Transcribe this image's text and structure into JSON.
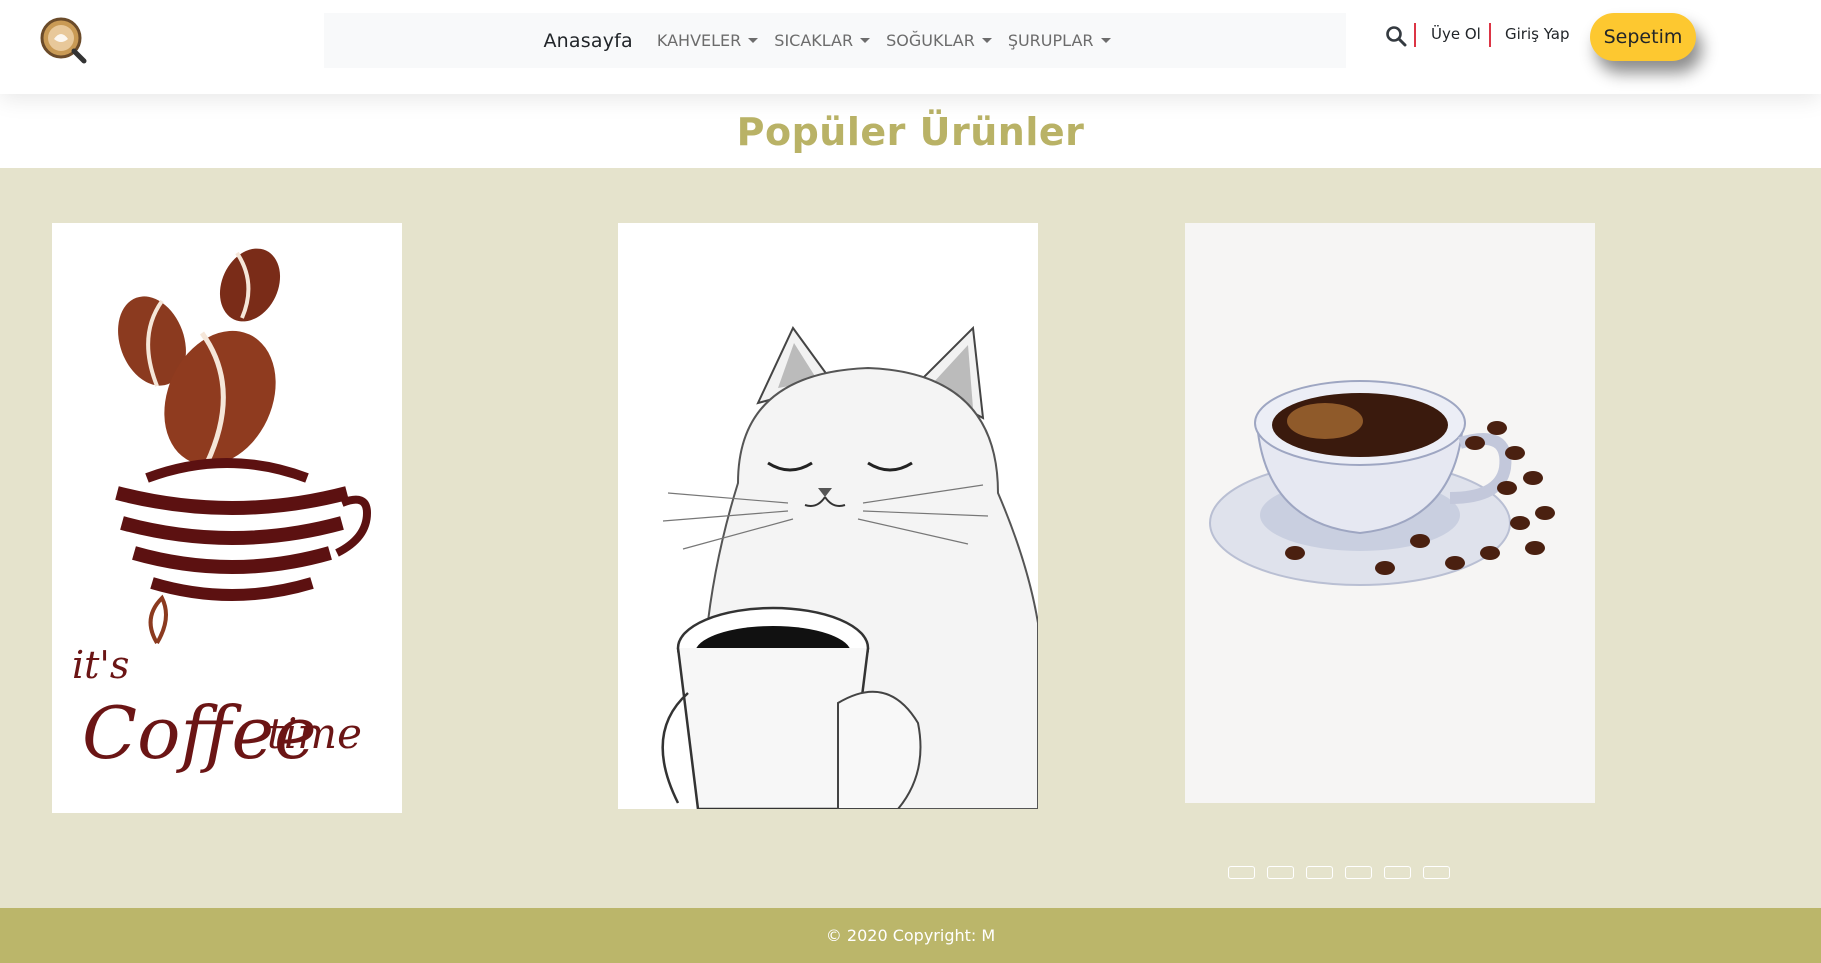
{
  "header": {
    "logo_icon": "coffee-logo-icon",
    "nav": {
      "home": "Anasayfa",
      "menus": [
        {
          "label": "KAHVELER"
        },
        {
          "label": "SICAKLAR"
        },
        {
          "label": "SOĞUKLAR"
        },
        {
          "label": "ŞURUPLAR"
        }
      ]
    },
    "search_icon": "search-icon",
    "signup": "Üye Ol",
    "login": "Giriş Yap",
    "cart": "Sepetim"
  },
  "main": {
    "title": "Popüler Ürünler",
    "products": [
      {
        "image": "coffee-beans-cup-illustration",
        "caption_art": "it's Coffee time"
      },
      {
        "image": "cat-holding-coffee-mug-sketch"
      },
      {
        "image": "watercolor-coffee-cup-with-beans"
      }
    ],
    "indicator_count": 6
  },
  "footer": {
    "copyright": "© 2020 Copyright: M"
  },
  "colors": {
    "title": "#b9b266",
    "carousel_bg": "#e5e3cc",
    "footer_bg": "#bbb66a",
    "cart_button": "#fdc830",
    "separator": "#dc3545"
  }
}
